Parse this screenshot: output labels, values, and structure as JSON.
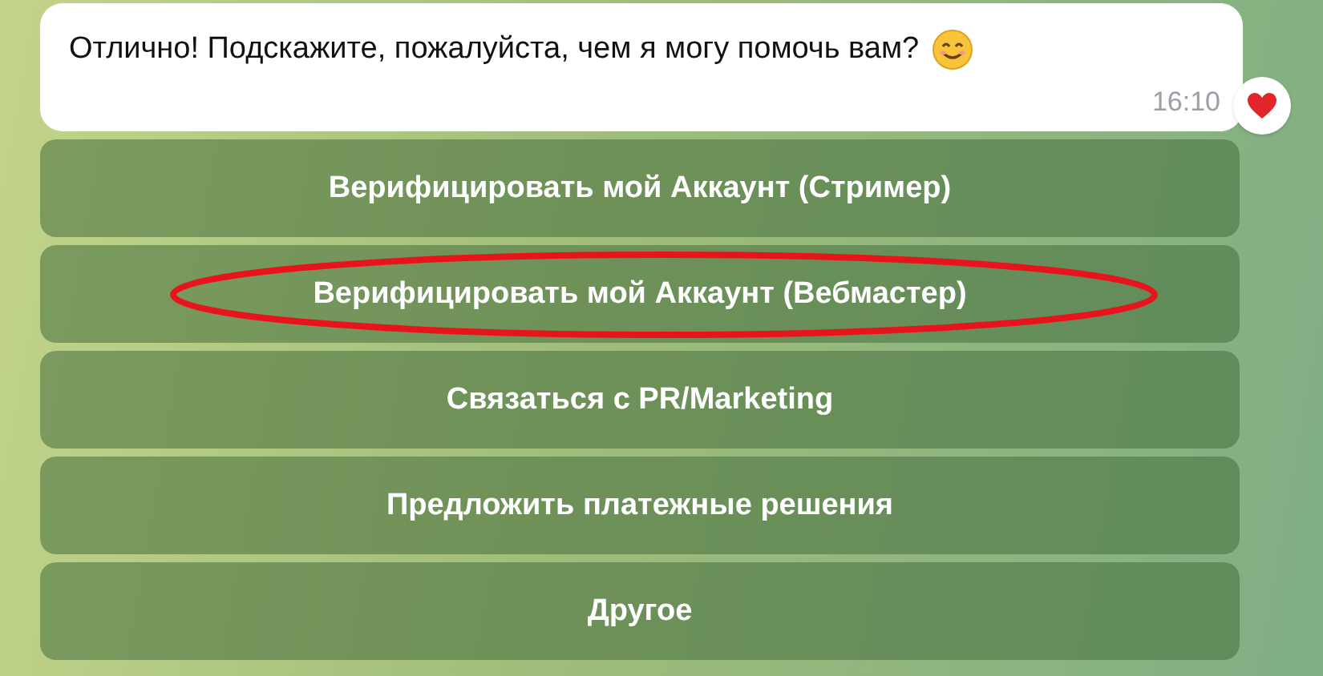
{
  "message": {
    "text": "Отлично! Подскажите, пожалуйста, чем я могу помочь вам?",
    "time": "16:10",
    "reaction": {
      "kind": "heart"
    }
  },
  "buttons": [
    {
      "label": "Верифицировать мой Аккаунт (Стример)",
      "highlighted": false
    },
    {
      "label": "Верифицировать мой Аккаунт (Вебмастер)",
      "highlighted": true
    },
    {
      "label": "Связаться с PR/Marketing",
      "highlighted": false
    },
    {
      "label": "Предложить платежные решения",
      "highlighted": false
    },
    {
      "label": "Другое",
      "highlighted": false
    }
  ]
}
